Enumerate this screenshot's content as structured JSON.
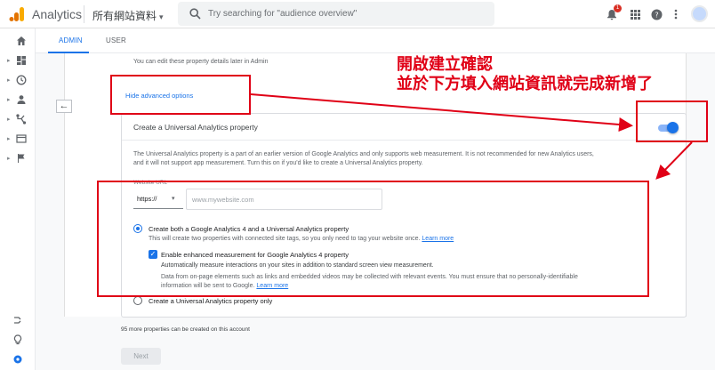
{
  "topbar": {
    "app_title": "Analytics",
    "account": "所有網站資料",
    "search_placeholder": "Try searching for \"audience overview\"",
    "notification_count": "1",
    "icons": [
      "analytics-logo-icon",
      "search-icon",
      "notifications-icon",
      "apps-grid-icon",
      "help-icon",
      "more-vert-icon",
      "avatar"
    ]
  },
  "leftnav": {
    "items": [
      "home-icon",
      "dashboard-icon",
      "clock-icon",
      "person-icon",
      "acquisition-icon",
      "behavior-icon",
      "flag-icon"
    ],
    "bottom": [
      "attribution-icon",
      "lightbulb-icon",
      "settings-icon"
    ]
  },
  "tabs": [
    {
      "label": "ADMIN",
      "active": true
    },
    {
      "label": "USER",
      "active": false
    }
  ],
  "form": {
    "edit_note": "You can edit these property details later in Admin",
    "hide_advanced": "Hide advanced options",
    "ua_title": "Create a Universal Analytics property",
    "ua_toggle_on": true,
    "ua_desc_line1": "The Universal Analytics property is a part of an earlier version of Google Analytics and only supports web measurement. It is not recommended for new Analytics users,",
    "ua_desc_line2": "and it will not support app measurement. Turn this on if you'd like to create a Universal Analytics property.",
    "website_url_label": "Website URL",
    "protocol": "https://",
    "url_placeholder": "www.mywebsite.com",
    "radio_both_label": "Create both a Google Analytics 4 and a Universal Analytics property",
    "radio_both_desc": "This will create two properties with connected site tags, so you only need to tag your website once.",
    "learn_more": "Learn more",
    "checkbox_label": "Enable enhanced measurement for Google Analytics 4 property",
    "checkbox_sub": "Automatically measure interactions on your sites in addition to standard screen view measurement.",
    "checkbox_desc_line1": "Data from on-page elements such as links and embedded videos may be collected with relevant events. You must ensure that no personally-identifiable",
    "checkbox_desc_line2": "information will be sent to Google.",
    "radio_ua_label": "Create a Universal Analytics property only",
    "more_props": "95 more properties can be created on this account",
    "next": "Next"
  },
  "annotation": {
    "line1": "開啟建立確認",
    "line2": "並於下方填入網站資訊就完成新增了",
    "color": "#e00016"
  }
}
